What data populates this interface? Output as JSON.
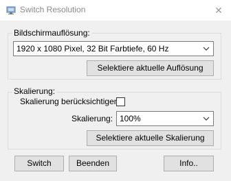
{
  "window": {
    "title": "Switch Resolution",
    "close_glyph": "✕",
    "icon": "monitor-icon"
  },
  "resolution_group": {
    "label": "Bildschirmauflösung:",
    "selected_mode": "1920 x 1080 Pixel, 32 Bit Farbtiefe, 60 Hz",
    "select_button": "Selektiere aktuelle Auflösung"
  },
  "scaling_group": {
    "label": "Skalierung:",
    "consider_label": "Skalierung berücksichtigen:",
    "consider_checked": false,
    "scaling_label": "Skalierung:",
    "scaling_value": "100%",
    "select_button": "Selektiere aktuelle Skalierung"
  },
  "footer": {
    "switch_button": "Switch",
    "exit_button": "Beenden",
    "info_button": "Info.."
  },
  "colors": {
    "button_bg": "#e1e1e1",
    "dialog_bg": "#f0f0f0",
    "title_text": "#8a8a8a"
  }
}
